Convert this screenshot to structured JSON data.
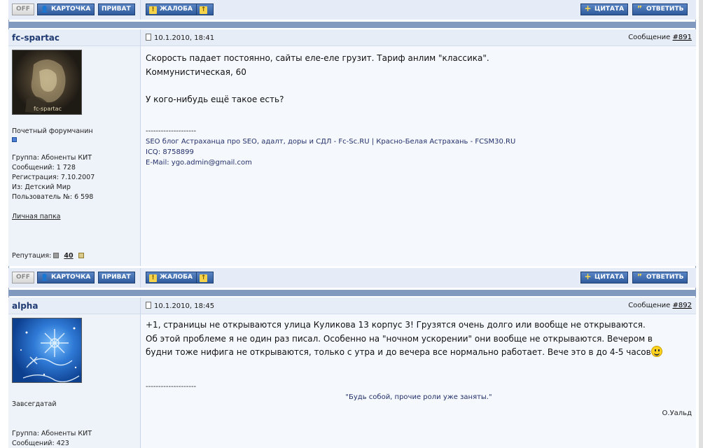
{
  "buttons": {
    "off": "OFF",
    "card": "КАРТОЧКА",
    "private": "ПРИВАТ",
    "complaint": "ЖАЛОБА",
    "up": "↑",
    "quote": "ЦИТАТА",
    "reply": "ОТВЕТИТЬ"
  },
  "posts": [
    {
      "author": "fc-spartac",
      "date": "10.1.2010, 18:41",
      "message_label": "Сообщение",
      "message_no": "#891",
      "avatar_caption": "fc-spartac",
      "rank": "Почетный форумчанин",
      "group": "Группа: Абоненты КИТ",
      "posts_count": "Сообщений: 1 728",
      "registered": "Регистрация: 7.10.2007",
      "location": "Из: Детский Мир",
      "user_no": "Пользователь №: 6 598",
      "personal_folder": "Личная папка",
      "reputation_label": "Репутация:",
      "reputation_value": "40",
      "text_lines": [
        "Скорость падает постоянно, сайты еле-еле грузит. Тариф анлим \"классика\".",
        "Коммунистическая, 60",
        "",
        "У кого-нибудь ещё такое есть?"
      ],
      "signature_dash": "--------------------",
      "signature_lines": [
        "SEO блог Астраханца про SEO, адалт, доры и СДЛ - Fc-Sc.RU | Красно-Белая Астрахань - FCSM30.RU",
        "ICQ: 8758899",
        "E-Mail: ygo.admin@gmail.com"
      ]
    },
    {
      "author": "alpha",
      "date": "10.1.2010, 18:45",
      "message_label": "Сообщение",
      "message_no": "#892",
      "rank": "Завсегдатай",
      "group": "Группа: Абоненты КИТ",
      "posts_count": "Сообщений: 423",
      "text_lines": [
        "+1, страницы не открываются улица Куликова 13 корпус 3! Грузятся очень долго или вообще не открываются.",
        "Об этой проблеме я не один раз писал. Особенно на \"ночном ускорении\" они вообще не открываются. Вечером в",
        "будни тоже нифига не открываются, только с утра и до вечера все нормально работает. Вече это в до 4-5 часов"
      ],
      "signature_dash": "--------------------",
      "quote": "\"Будь собой, прочие роли уже заняты.\"",
      "quote_author": "О.Уальд"
    }
  ],
  "colors": {
    "header_bg": "#e7edf6",
    "separator": "#8299bf",
    "button_blue": "#2f5b9c",
    "author": "#1f3a72"
  }
}
